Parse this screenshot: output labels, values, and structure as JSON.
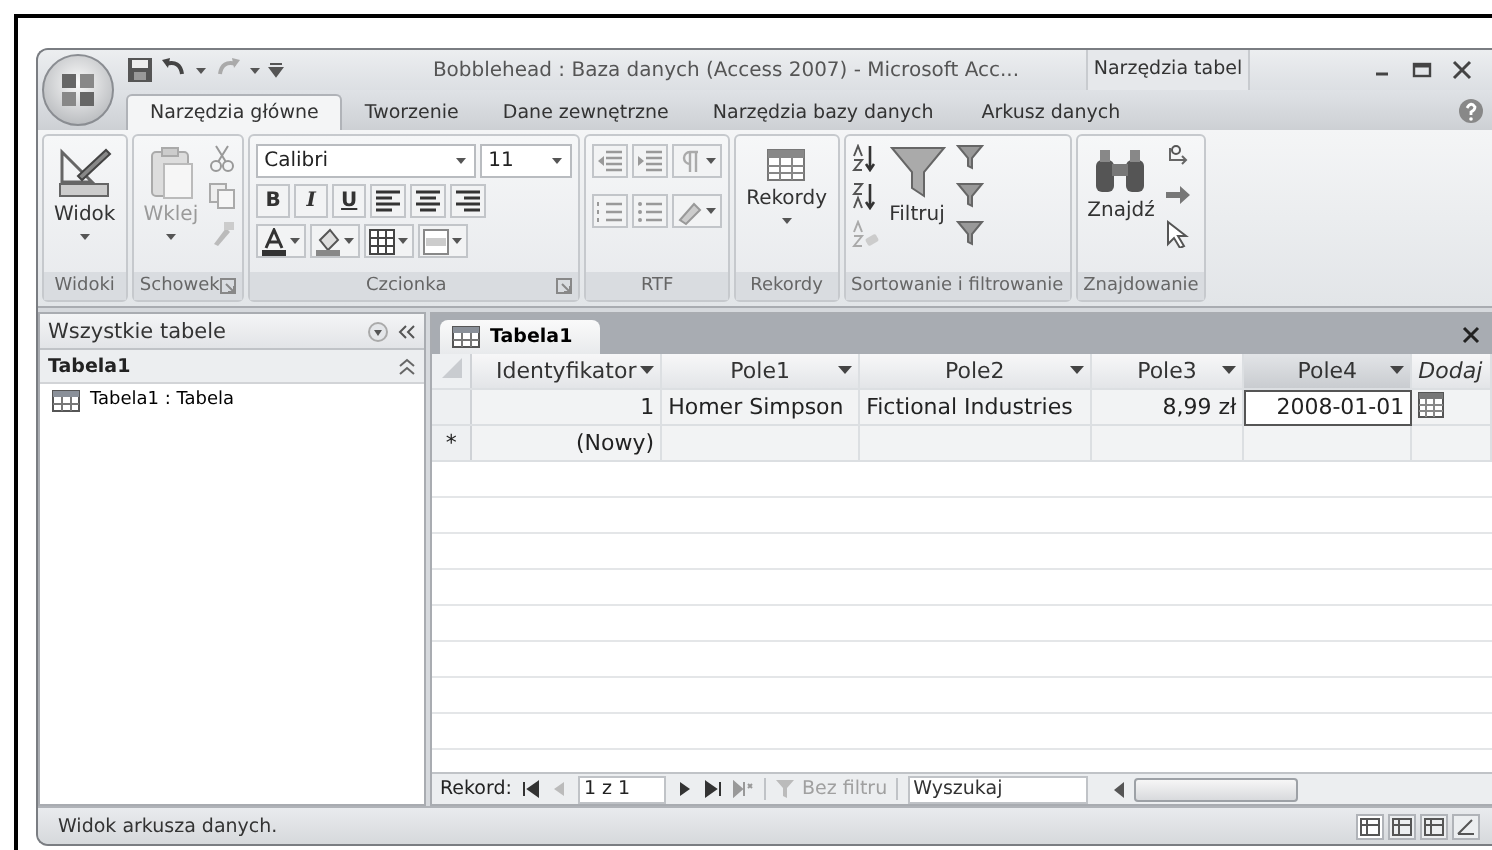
{
  "window": {
    "title": "Bobblehead : Baza danych (Access 2007) - Microsoft Acc...",
    "context_title": "Narzędzia tabel"
  },
  "ribbon_tabs": [
    {
      "label": "Narzędzia główne",
      "selected": true
    },
    {
      "label": "Tworzenie",
      "selected": false
    },
    {
      "label": "Dane zewnętrzne",
      "selected": false
    },
    {
      "label": "Narzędzia bazy danych",
      "selected": false
    },
    {
      "label": "Arkusz danych",
      "selected": false,
      "contextual": true
    }
  ],
  "ribbon_groups": [
    {
      "label": "Widoki",
      "kind": "view",
      "big_button": {
        "label": "Widok",
        "disabled": false
      },
      "launcher": false
    },
    {
      "label": "Schowek",
      "kind": "clipboard",
      "big_button": {
        "label": "Wklej",
        "disabled": true
      },
      "launcher": true
    },
    {
      "label": "Czcionka",
      "kind": "font",
      "font": "Calibri",
      "size": "11",
      "format_buttons": [
        "B",
        "I",
        "U"
      ],
      "launcher": true
    },
    {
      "label": "RTF",
      "kind": "rtf",
      "launcher": false
    },
    {
      "label": "Rekordy",
      "kind": "records",
      "big_button": {
        "label": "Rekordy",
        "disabled": false
      },
      "launcher": false
    },
    {
      "label": "Sortowanie i filtrowanie",
      "kind": "sort",
      "big_button": {
        "label": "Filtruj",
        "disabled": false
      },
      "launcher": false
    },
    {
      "label": "Znajdowanie",
      "kind": "find",
      "big_button": {
        "label": "Znajdź",
        "disabled": false
      },
      "launcher": false
    }
  ],
  "nav_pane": {
    "title": "Wszystkie tabele",
    "groups": [
      {
        "label": "Tabela1",
        "expanded": true,
        "items": [
          {
            "label": "Tabela1 : Tabela",
            "selected": false
          }
        ]
      }
    ]
  },
  "document_tab": {
    "label": "Tabela1"
  },
  "datasheet": {
    "columns": [
      {
        "label": "Identyfikator",
        "selected": false
      },
      {
        "label": "Pole1",
        "selected": false
      },
      {
        "label": "Pole2",
        "selected": false
      },
      {
        "label": "Pole3",
        "selected": false
      },
      {
        "label": "Pole4",
        "selected": true
      }
    ],
    "add_column": "Dodaj",
    "rows": [
      {
        "kind": "record",
        "cells": [
          {
            "text": "1",
            "selected": false
          },
          {
            "text": "Homer Simpson",
            "selected": false
          },
          {
            "text": "Fictional Industries",
            "selected": false
          },
          {
            "text": "8,99 zł",
            "selected": false
          },
          {
            "text": "2008-01-01",
            "selected": true
          }
        ]
      },
      {
        "kind": "new",
        "marker": "*",
        "cells": [
          {
            "text": "(Nowy)",
            "selected": false
          }
        ]
      }
    ]
  },
  "record_nav": {
    "label": "Rekord:",
    "position": "1 z 1",
    "filter": {
      "label": "Bez filtru",
      "disabled": true
    },
    "search": {
      "placeholder": "Wyszukaj"
    }
  },
  "status_bar": {
    "text": "Widok arkusza danych."
  }
}
